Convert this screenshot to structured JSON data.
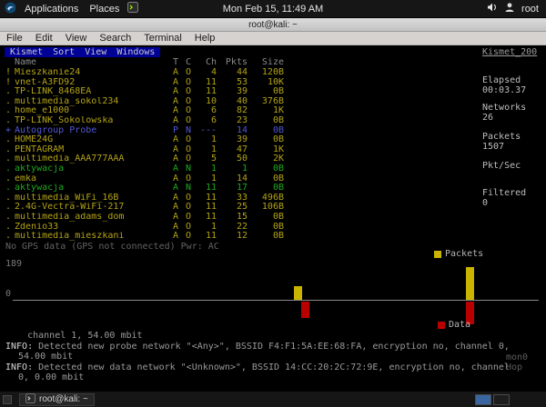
{
  "top_panel": {
    "applications": "Applications",
    "places": "Places",
    "clock": "Mon Feb 15, 11:49 AM",
    "user": "root"
  },
  "window": {
    "title": "root@kali: ~",
    "menus": [
      "File",
      "Edit",
      "View",
      "Search",
      "Terminal",
      "Help"
    ]
  },
  "kismet": {
    "menu_items": [
      "Kismet",
      "Sort",
      "View",
      "Windows"
    ],
    "server_tab": "Kismet_200",
    "columns": [
      "Name",
      "T",
      "C",
      "Ch",
      "Pkts",
      "Size"
    ],
    "networks": [
      {
        "flag": "!",
        "name": "Mieszkanie24",
        "t": "A",
        "c": "O",
        "ch": "4",
        "pkts": "44",
        "size": "120B",
        "color": "yellow"
      },
      {
        "flag": "!",
        "name": "vnet-A3FD92",
        "t": "A",
        "c": "O",
        "ch": "11",
        "pkts": "53",
        "size": "10K",
        "color": "yellow"
      },
      {
        "flag": ".",
        "name": "TP-LINK_8468EA",
        "t": "A",
        "c": "O",
        "ch": "11",
        "pkts": "39",
        "size": "0B",
        "color": "yellow"
      },
      {
        "flag": ".",
        "name": "multimedia_sokol234",
        "t": "A",
        "c": "O",
        "ch": "10",
        "pkts": "40",
        "size": "376B",
        "color": "yellow"
      },
      {
        "flag": ".",
        "name": "home_e1000",
        "t": "A",
        "c": "O",
        "ch": "6",
        "pkts": "82",
        "size": "1K",
        "color": "yellow"
      },
      {
        "flag": ".",
        "name": "TP-LINK_Sokolowska",
        "t": "A",
        "c": "O",
        "ch": "6",
        "pkts": "23",
        "size": "0B",
        "color": "yellow"
      },
      {
        "flag": "+",
        "name": "Autogroup Probe",
        "t": "P",
        "c": "N",
        "ch": "---",
        "pkts": "14",
        "size": "0B",
        "color": "blue"
      },
      {
        "flag": ".",
        "name": "HOME24G",
        "t": "A",
        "c": "O",
        "ch": "1",
        "pkts": "39",
        "size": "0B",
        "color": "yellow"
      },
      {
        "flag": ".",
        "name": "PENTAGRAM",
        "t": "A",
        "c": "O",
        "ch": "1",
        "pkts": "47",
        "size": "1K",
        "color": "yellow"
      },
      {
        "flag": ".",
        "name": "multimedia_AAA777AAA",
        "t": "A",
        "c": "O",
        "ch": "5",
        "pkts": "50",
        "size": "2K",
        "color": "yellow"
      },
      {
        "flag": ".",
        "name": "aktywacja",
        "t": "A",
        "c": "N",
        "ch": "1",
        "pkts": "1",
        "size": "0B",
        "color": "green"
      },
      {
        "flag": ".",
        "name": "emka",
        "t": "A",
        "c": "O",
        "ch": "1",
        "pkts": "14",
        "size": "0B",
        "color": "yellow"
      },
      {
        "flag": ".",
        "name": "aktywacja",
        "t": "A",
        "c": "N",
        "ch": "11",
        "pkts": "17",
        "size": "0B",
        "color": "green"
      },
      {
        "flag": ".",
        "name": "multimedia_WiFi_16B",
        "t": "A",
        "c": "O",
        "ch": "11",
        "pkts": "33",
        "size": "496B",
        "color": "yellow"
      },
      {
        "flag": ".",
        "name": "2.4G-Vectra-WiFi-217",
        "t": "A",
        "c": "O",
        "ch": "11",
        "pkts": "25",
        "size": "106B",
        "color": "yellow"
      },
      {
        "flag": ".",
        "name": "multimedia_adams_dom",
        "t": "A",
        "c": "O",
        "ch": "11",
        "pkts": "15",
        "size": "0B",
        "color": "yellow"
      },
      {
        "flag": ".",
        "name": "Zdenio33",
        "t": "A",
        "c": "O",
        "ch": "1",
        "pkts": "22",
        "size": "0B",
        "color": "yellow"
      },
      {
        "flag": ".",
        "name": "multimedia_mieszkani",
        "t": "A",
        "c": "O",
        "ch": "11",
        "pkts": "12",
        "size": "0B",
        "color": "yellow"
      }
    ],
    "sidebar": {
      "elapsed": {
        "label": "Elapsed",
        "value": "00:03.37"
      },
      "networks": {
        "label": "Networks",
        "value": "26"
      },
      "packets": {
        "label": "Packets",
        "value": "1507"
      },
      "pktsec": {
        "label": "Pkt/Sec",
        "value": ""
      },
      "filtered": {
        "label": "Filtered",
        "value": "0"
      }
    },
    "gps_status": "No GPS data (GPS not connected) Pwr: AC",
    "graph": {
      "max_label": "189",
      "zero_label": "0",
      "max_value": 189,
      "packets_legend": "Packets",
      "data_legend": "Data",
      "packets_color": "#c9b400",
      "data_color": "#b80000",
      "packets_bars": [
        {
          "pos": 53.5,
          "value": 80
        },
        {
          "pos": 86.2,
          "value": 189
        }
      ],
      "data_bars": [
        {
          "pos": 54.8,
          "value": 95
        },
        {
          "pos": 86.2,
          "value": 130
        }
      ]
    },
    "messages": [
      {
        "prefix": "",
        "text": "    channel 1, 54.00 mbit"
      },
      {
        "prefix": "INFO:",
        "text": " Detected new probe network \"<Any>\", BSSID F4:F1:5A:EE:68:FA, encryption no, channel 0, 54.00 mbit"
      },
      {
        "prefix": "INFO:",
        "text": " Detected new data network \"<Unknown>\", BSSID 14:CC:20:2C:72:9E, encryption no, channel 0, 0.00 mbit"
      }
    ],
    "interface": "mon0",
    "hop": "Hop"
  },
  "taskbar": {
    "window_button": "root@kali: ~",
    "workspace_count": 2,
    "active_workspace": 1
  },
  "icons": {
    "kali-logo": "#1a5fb4",
    "terminal-launcher": "#9fef00",
    "speaker": "#e8e8e8",
    "user": "#dddddd"
  }
}
